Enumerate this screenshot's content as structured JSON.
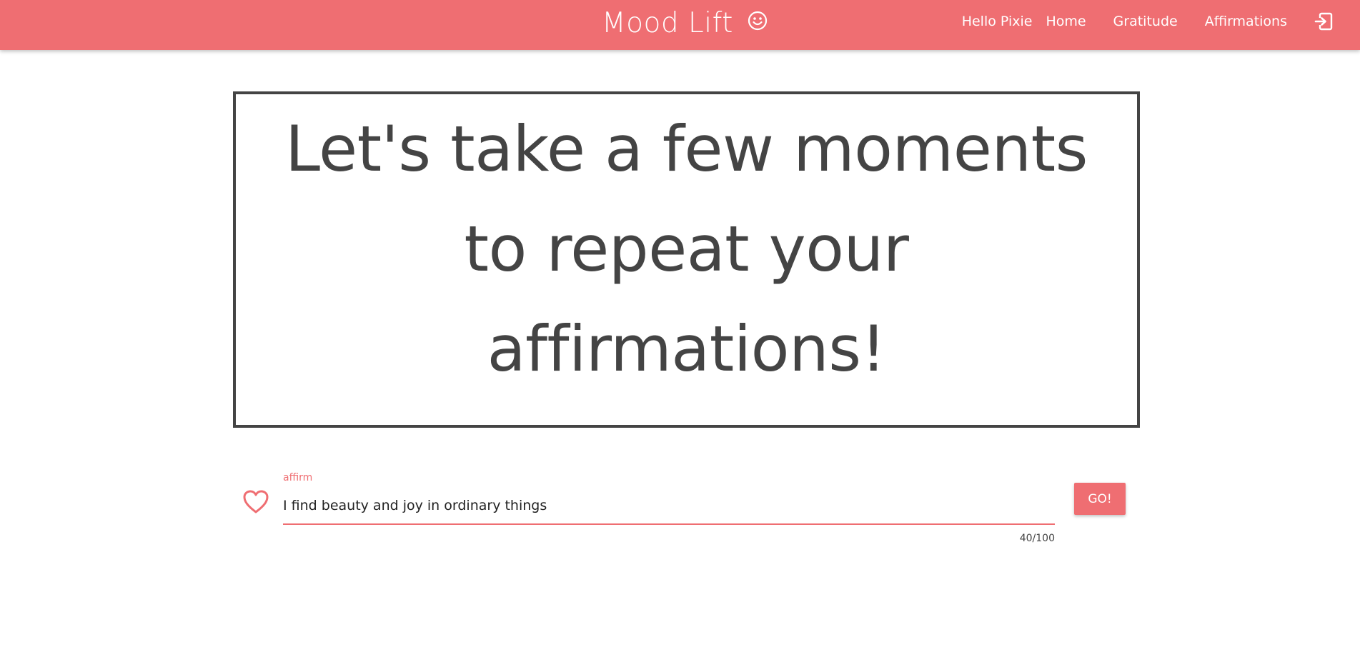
{
  "header": {
    "title": "Mood Lift",
    "brand_icon": "smiley-icon",
    "greeting": "Hello Pixie",
    "nav": [
      "Home",
      "Gratitude",
      "Affirmations"
    ],
    "logout_icon": "logout-icon",
    "background_color": "#ef6e72"
  },
  "hero": {
    "message": "Let's take a few moments to repeat your affirmations!"
  },
  "affirmation_form": {
    "icon": "heart-icon",
    "label": "affirm",
    "value": "I find beauty and joy in ordinary things",
    "counter": "40/100",
    "submit_label": "GO!",
    "accent_color": "#ef6e72"
  }
}
